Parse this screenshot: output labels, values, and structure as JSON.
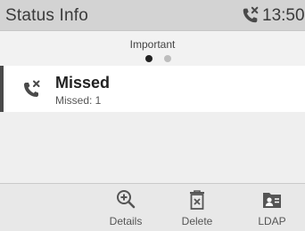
{
  "status_bar": {
    "title": "Status Info",
    "time": "13:50",
    "indicator_icon": "missed-call-icon"
  },
  "section": {
    "title": "Important",
    "pages": 2,
    "active_page": 1
  },
  "items": [
    {
      "icon": "missed-call-icon",
      "title": "Missed",
      "subtitle": "Missed: 1"
    }
  ],
  "softkeys": [
    {
      "label": "Details",
      "icon": "zoom-in-icon"
    },
    {
      "label": "Delete",
      "icon": "trash-icon"
    },
    {
      "label": "LDAP",
      "icon": "contact-card-icon"
    }
  ],
  "colors": {
    "status_bar": "#d3d3d3",
    "background": "#efefef",
    "item_background": "#ffffff",
    "selection_marker": "#4a4a4a"
  }
}
